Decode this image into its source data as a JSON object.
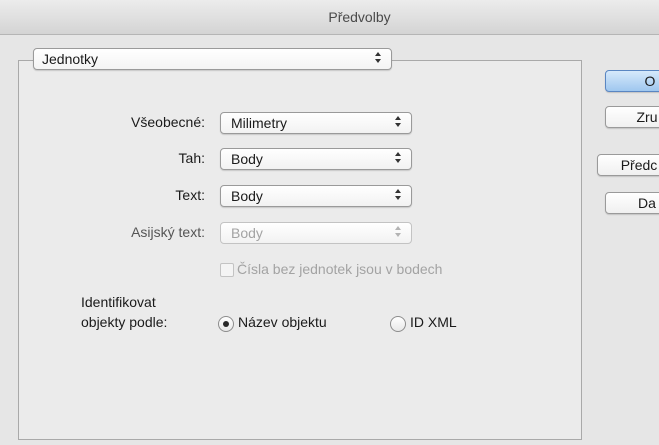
{
  "window": {
    "title": "Předvolby"
  },
  "section_popup": {
    "value": "Jednotky"
  },
  "units": {
    "general": {
      "label": "Všeobecné:",
      "value": "Milimetry"
    },
    "stroke": {
      "label": "Tah:",
      "value": "Body"
    },
    "text": {
      "label": "Text:",
      "value": "Body"
    },
    "asian_text": {
      "label": "Asijský text:",
      "value": "Body",
      "disabled": true
    }
  },
  "checkbox": {
    "label": "Čísla bez jednotek jsou v bodech",
    "checked": false,
    "disabled": true
  },
  "identify": {
    "label_line1": "Identifikovat",
    "label_line2": "objekty podle:",
    "options": [
      {
        "label": "Název objektu",
        "selected": true
      },
      {
        "label": "ID XML",
        "selected": false
      }
    ]
  },
  "buttons": {
    "ok": "O",
    "cancel": "Zru",
    "prev": "Předc",
    "next": "Da"
  }
}
